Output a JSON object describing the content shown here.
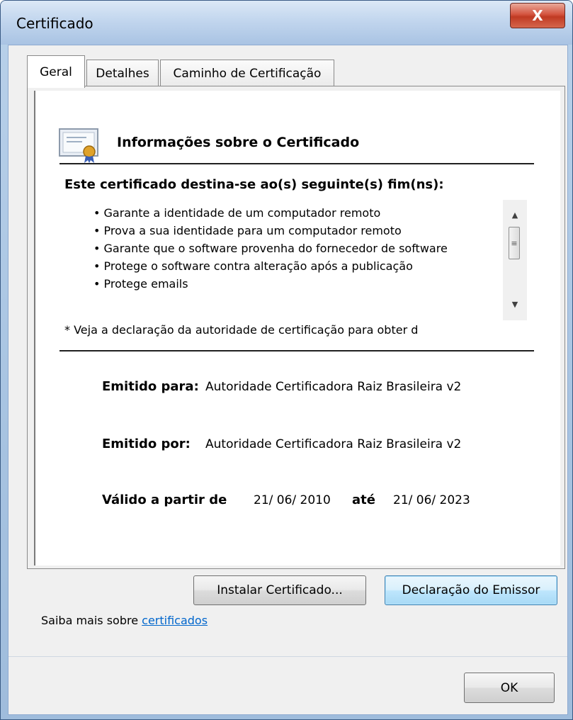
{
  "window": {
    "title": "Certificado",
    "close_glyph": "X"
  },
  "tabs": [
    {
      "label": "Geral",
      "active": true
    },
    {
      "label": "Detalhes",
      "active": false
    },
    {
      "label": "Caminho de Certificação",
      "active": false
    }
  ],
  "general": {
    "icon": "certificate-icon",
    "info_title": "Informações sobre o Certificado",
    "purpose_title": "Este certificado destina-se ao(s) seguinte(s) fim(ns):",
    "purposes": [
      "• Garante a identidade de um computador remoto",
      "• Prova a sua identidade para um computador remoto",
      "• Garante que o software provenha do fornecedor de software",
      "• Protege o software contra alteração após a publicação",
      "• Protege emails"
    ],
    "note": "* Veja a declaração da autoridade de certificação para obter d",
    "issued_to_label": "Emitido para:",
    "issued_to_value": "Autoridade Certificadora Raiz Brasileira v2",
    "issued_by_label": "Emitido por:",
    "issued_by_value": "Autoridade Certificadora Raiz Brasileira v2",
    "valid_from_label": "Válido a partir de",
    "valid_from_value": "21/ 06/ 2010",
    "valid_to_label": "até",
    "valid_to_value": "21/ 06/ 2023"
  },
  "buttons": {
    "install": "Instalar Certificado...",
    "issuer_statement": "Declaração do Emissor",
    "ok": "OK"
  },
  "learn_more": {
    "prefix": "Saiba mais sobre ",
    "link": "certificados"
  },
  "colors": {
    "link": "#0066cc",
    "titlebar": "#b9d1ea",
    "close": "#c8452e"
  }
}
